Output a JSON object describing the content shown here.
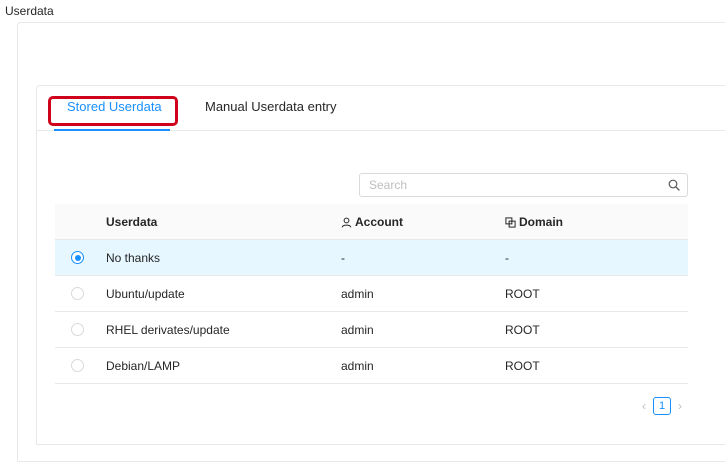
{
  "section": {
    "label": "Userdata"
  },
  "tabs": [
    {
      "label": "Stored Userdata",
      "active": true
    },
    {
      "label": "Manual Userdata entry",
      "active": false
    }
  ],
  "search": {
    "placeholder": "Search",
    "value": ""
  },
  "table": {
    "headers": {
      "name": "Userdata",
      "account": "Account",
      "domain": "Domain"
    },
    "rows": [
      {
        "name": "No thanks",
        "account": "-",
        "domain": "-",
        "selected": true
      },
      {
        "name": "Ubuntu/update",
        "account": "admin",
        "domain": "ROOT",
        "selected": false
      },
      {
        "name": "RHEL derivates/update",
        "account": "admin",
        "domain": "ROOT",
        "selected": false
      },
      {
        "name": "Debian/LAMP",
        "account": "admin",
        "domain": "ROOT",
        "selected": false
      }
    ]
  },
  "pagination": {
    "current_page": "1",
    "prev_icon": "chevron-left-icon",
    "next_icon": "chevron-right-icon"
  },
  "colors": {
    "accent": "#1890ff",
    "highlight": "#d0021b",
    "selected_row": "#e6f7ff"
  }
}
